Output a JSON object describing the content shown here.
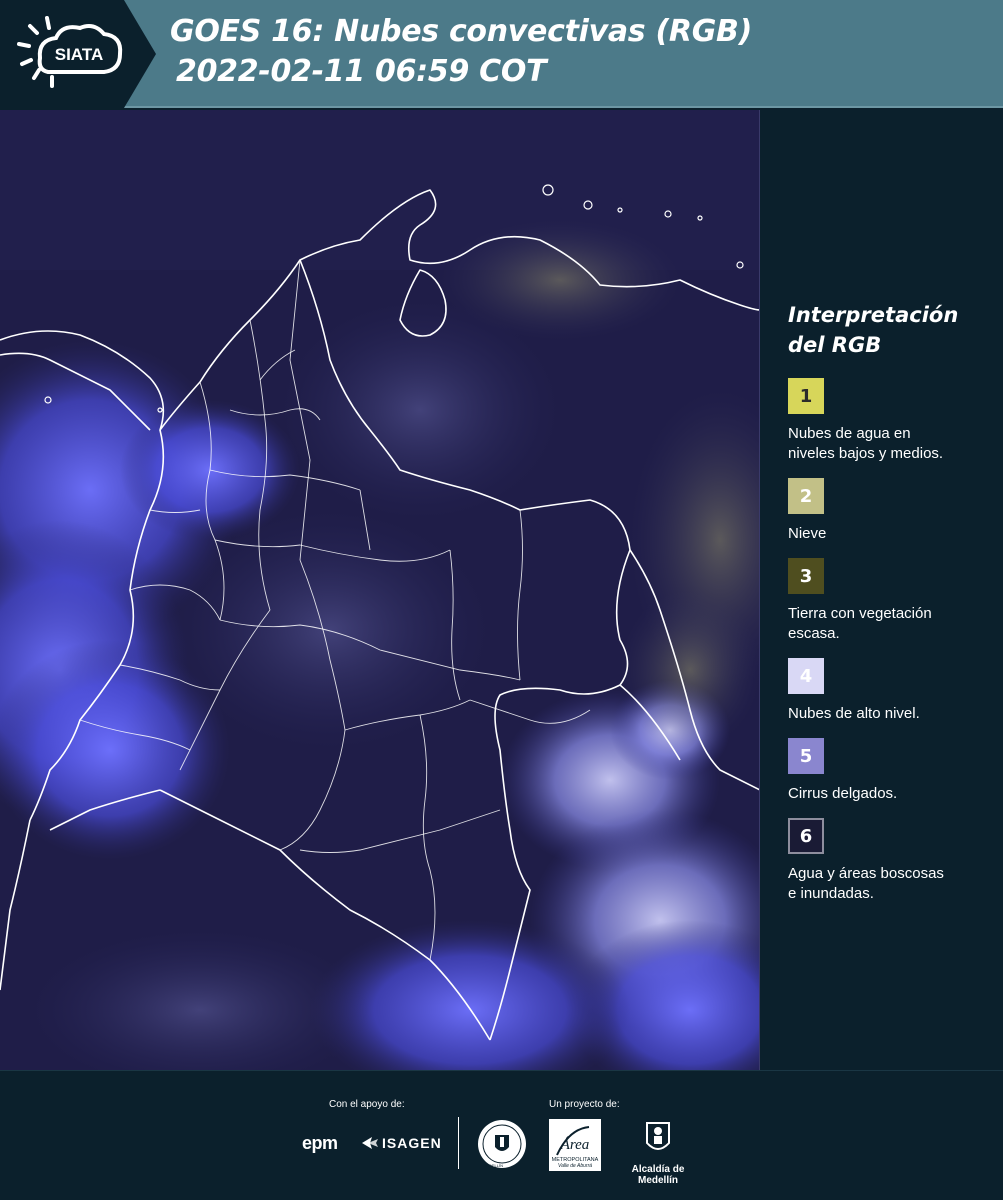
{
  "header": {
    "logo_text": "SIATA",
    "title_line1": "GOES 16: Nubes convectivas (RGB)",
    "title_line2": "2022-02-11 06:59 COT"
  },
  "legend": {
    "title_line1": "Interpretación",
    "title_line2": "del RGB",
    "items": [
      {
        "number": "1",
        "color": "#d7d65a",
        "label_line1": "Nubes de agua en",
        "label_line2": "niveles bajos y medios."
      },
      {
        "number": "2",
        "color": "#c2c087",
        "label_line1": "Nieve",
        "label_line2": ""
      },
      {
        "number": "3",
        "color": "#4f4e1f",
        "label_line1": "Tierra con vegetación",
        "label_line2": "escasa."
      },
      {
        "number": "4",
        "color": "#d9d8f5",
        "label_line1": "Nubes de alto nivel.",
        "label_line2": ""
      },
      {
        "number": "5",
        "color": "#8a86cf",
        "label_line1": "Cirrus delgados.",
        "label_line2": ""
      },
      {
        "number": "6",
        "color": "#1a1b35",
        "label_line1": "Agua y áreas boscosas",
        "label_line2": "e inundadas."
      }
    ]
  },
  "footer": {
    "support_label": "Con el apoyo de:",
    "project_label": "Un proyecto de:",
    "sponsor_1": "epm",
    "sponsor_2": "ISAGEN",
    "seal_text": "MEDELLÍN",
    "area_name": "Área",
    "area_sub1": "METROPOLITANA",
    "area_sub2": "Valle de Aburrá",
    "alcaldia": "Alcaldía de Medellín"
  },
  "colors": {
    "header_bg": "#4c7a89",
    "page_bg": "#0b202c",
    "map_bg": "#1e1c46",
    "convective_cloud": "#5a5cf0",
    "border_line": "#ffffff"
  }
}
